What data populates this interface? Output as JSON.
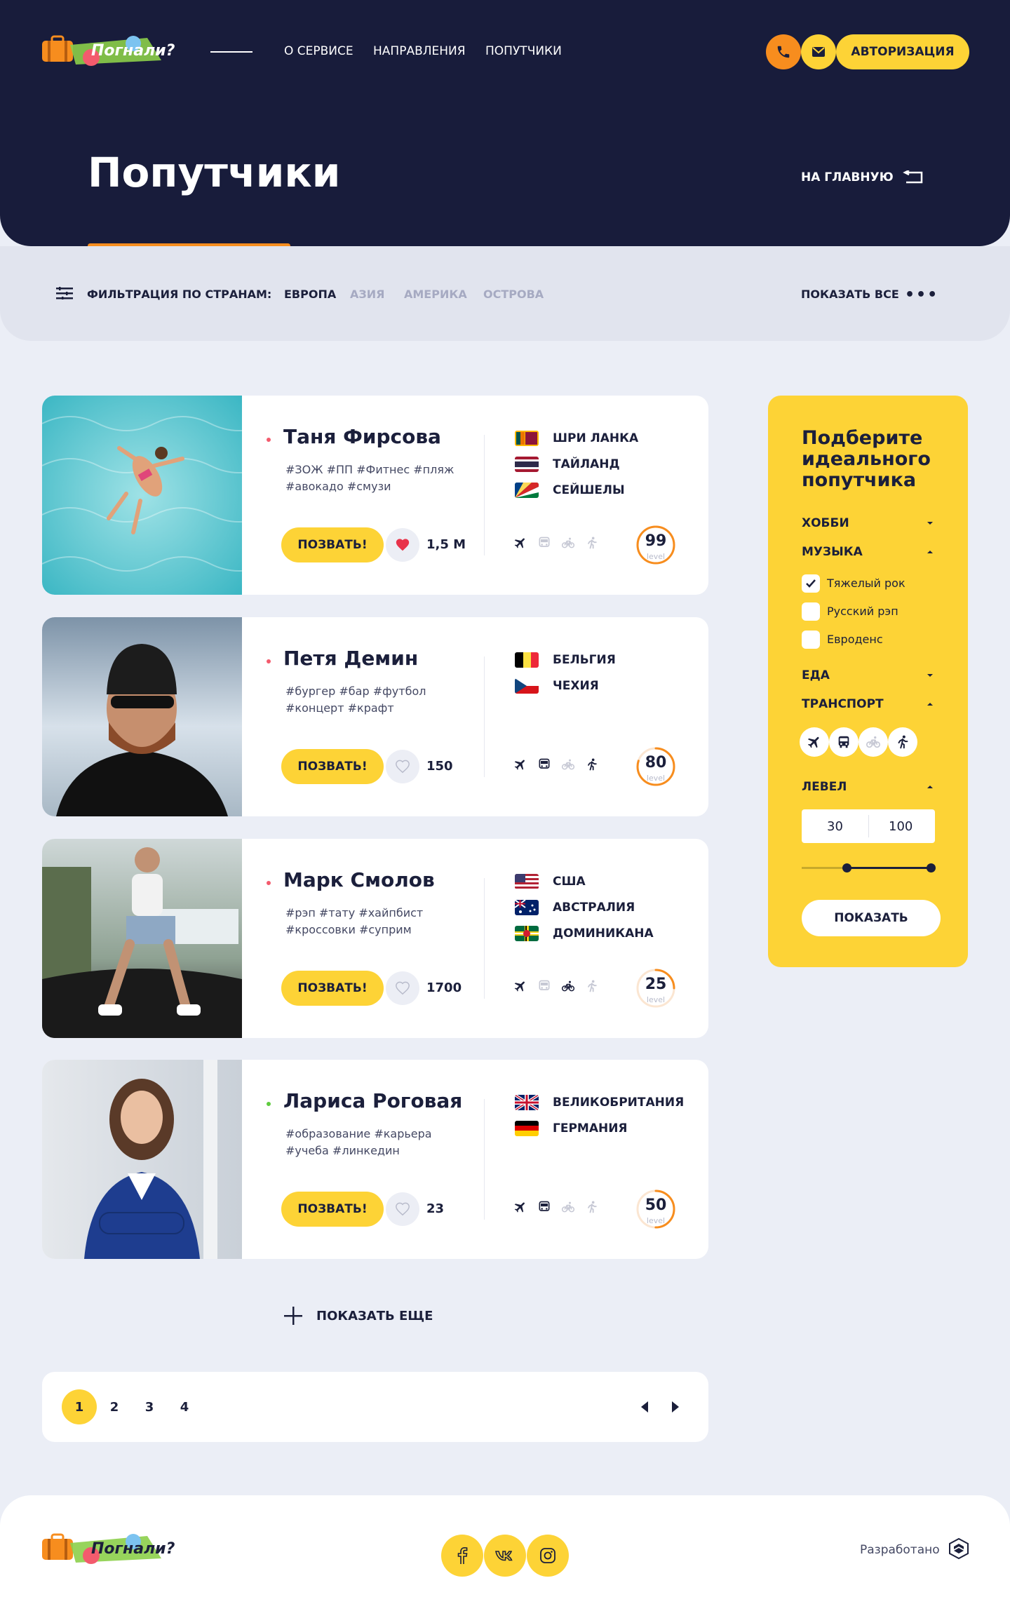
{
  "header": {
    "logo_text": "Погнали?",
    "nav": [
      "О СЕРВИСЕ",
      "НАПРАВЛЕНИЯ",
      "ПОПУТЧИКИ"
    ],
    "auth_label": "АВТОРИЗАЦИЯ",
    "page_title": "Попутчики",
    "home_link": "НА ГЛАВНУЮ"
  },
  "filter": {
    "label": "ФИЛЬТРАЦИЯ ПО СТРАНАМ:",
    "tabs": [
      "ЕВРОПА",
      "АЗИЯ",
      "АМЕРИКА",
      "ОСТРОВА"
    ],
    "active_tab": "ЕВРОПА",
    "show_all": "ПОКАЗАТЬ ВСЕ"
  },
  "cards": [
    {
      "name": "Таня Фирсова",
      "tags": "#ЗОЖ #ПП #Фитнес #пляж #авокадо #смузи",
      "call_label": "ПОЗВАТЬ!",
      "likes": "1,5 М",
      "liked": true,
      "countries": [
        "ШРИ ЛАНКА",
        "ТАЙЛАНД",
        "СЕЙШЕЛЫ"
      ],
      "level": 99,
      "level_label": "level",
      "status_color": "#f35b6d"
    },
    {
      "name": "Петя Демин",
      "tags": "#бургер #бар #футбол #концерт #крафт",
      "call_label": "ПОЗВАТЬ!",
      "likes": "150",
      "liked": false,
      "countries": [
        "БЕЛЬГИЯ",
        "ЧЕХИЯ"
      ],
      "level": 80,
      "level_label": "level",
      "status_color": "#f35b6d"
    },
    {
      "name": "Марк Смолов",
      "tags": "#рэп #тату #хайпбист #кроссовки #суприм",
      "call_label": "ПОЗВАТЬ!",
      "likes": "1700",
      "liked": false,
      "countries": [
        "США",
        "АВСТРАЛИЯ",
        "ДОМИНИКАНА"
      ],
      "level": 25,
      "level_label": "level",
      "status_color": "#f35b6d"
    },
    {
      "name": "Лариса Роговая",
      "tags": "#образование #карьера #учеба #линкедин",
      "call_label": "ПОЗВАТЬ!",
      "likes": "23",
      "liked": false,
      "countries": [
        "ВЕЛИКОБРИТАНИЯ",
        "ГЕРМАНИЯ"
      ],
      "level": 50,
      "level_label": "level",
      "status_color": "#5fcb3f"
    }
  ],
  "show_more": "ПОКАЗАТЬ ЕЩЕ",
  "pagination": {
    "pages": [
      "1",
      "2",
      "3",
      "4"
    ],
    "current": "1"
  },
  "sidebar": {
    "title": "Подберите идеального попутчика",
    "sections": [
      "ХОББИ",
      "МУЗЫКА",
      "ЕДА",
      "ТРАНСПОРТ",
      "ЛЕВЕЛ"
    ],
    "music_options": [
      {
        "label": "Тяжелый рок",
        "checked": true
      },
      {
        "label": "Русский рэп",
        "checked": false
      },
      {
        "label": "Евроденс",
        "checked": false
      }
    ],
    "level_from": "30",
    "level_to": "100",
    "submit": "ПОКАЗАТЬ"
  },
  "footer": {
    "logo_text": "Погнали?",
    "developed": "Разработано"
  },
  "colors": {
    "navy": "#181c3b",
    "yellow": "#fdd336",
    "orange": "#f78d1e",
    "background": "#ebeef6"
  }
}
